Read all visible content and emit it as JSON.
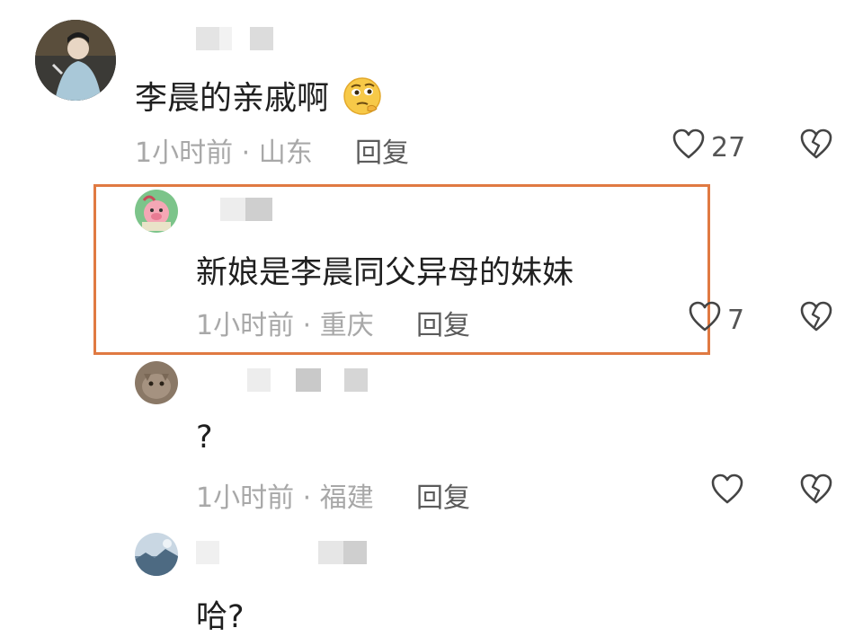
{
  "comments": [
    {
      "text": "李晨的亲戚啊",
      "time_location": "1小时前 · 山东",
      "reply_label": "回复",
      "likes": "27",
      "emoji": "thinking-face",
      "highlighted": false
    },
    {
      "text": "新娘是李晨同父异母的妹妹",
      "time_location": "1小时前 · 重庆",
      "reply_label": "回复",
      "likes": "7",
      "highlighted": true
    },
    {
      "text": "?",
      "time_location": "1小时前 · 福建",
      "reply_label": "回复",
      "likes": "",
      "highlighted": false
    },
    {
      "text": "哈?",
      "highlighted": false
    }
  ],
  "colors": {
    "highlight_border": "#e07a42",
    "meta_text": "#a8a8a8"
  },
  "icons": [
    "heart-outline-icon",
    "broken-heart-icon"
  ]
}
